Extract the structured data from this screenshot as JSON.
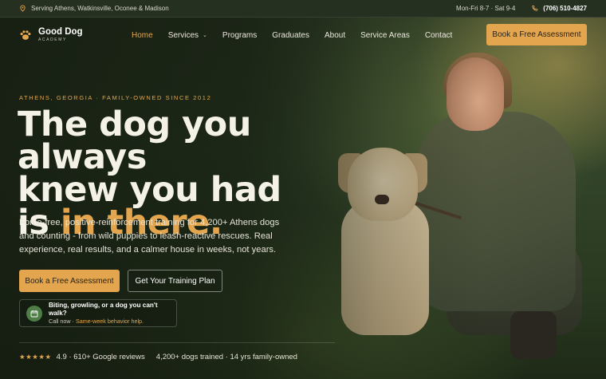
{
  "topbar": {
    "service_area": "Serving Athens, Watkinsville, Oconee & Madison",
    "hours": "Mon-Fri 8-7 · Sat 9-4",
    "phone": "(706) 510-4827"
  },
  "brand": {
    "name": "Good Dog",
    "tagline": "ACADEMY",
    "accent_color": "#e3a64e"
  },
  "nav": {
    "items": [
      {
        "label": "Home",
        "active": true
      },
      {
        "label": "Services",
        "dropdown": true
      },
      {
        "label": "Programs"
      },
      {
        "label": "Graduates"
      },
      {
        "label": "About"
      },
      {
        "label": "Service Areas"
      },
      {
        "label": "Contact"
      }
    ],
    "cta": "Book a Free Assessment"
  },
  "hero": {
    "eyebrow": "ATHENS, GEORGIA · FAMILY-OWNED SINCE 2012",
    "headline_1": "The dog you always",
    "headline_2": "knew you had",
    "headline_3": "is ",
    "headline_accent": "in there.",
    "lead": "Force-free, positive-reinforcement training for 4,200+ Athens dogs and counting - from wild puppies to leash-reactive rescues. Real experience, real results, and a calmer house in weeks, not years.",
    "primary_cta": "Book a Free Assessment",
    "secondary_cta": "Get Your Training Plan"
  },
  "callout": {
    "title": "Biting, growling, or a dog you can't walk?",
    "sub_prefix": "Call now · ",
    "sub_link": "Same-week behavior help.",
    "icon": "calendar-icon"
  },
  "stats": {
    "stars": "★★★★★",
    "rating": 4.9,
    "reviews": "4.9 · 610+ Google reviews",
    "trained": "4,200+ dogs trained · 14 yrs family-owned"
  }
}
